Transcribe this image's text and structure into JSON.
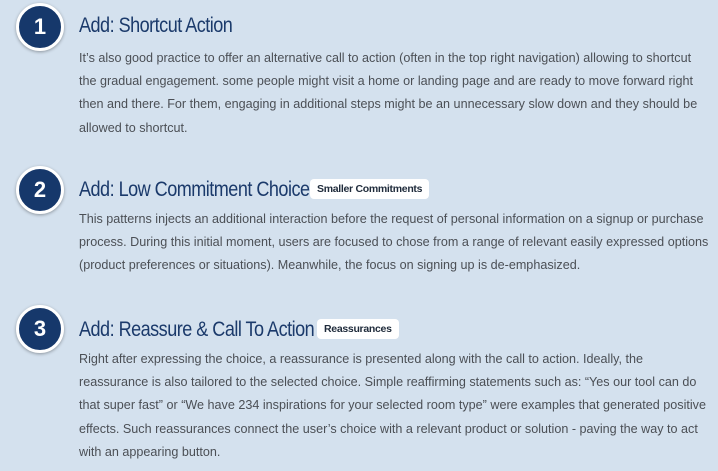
{
  "steps": [
    {
      "number": "1",
      "title": "Add: Shortcut Action",
      "tag": "",
      "description": "It’s also good practice to offer an alternative call to action (often in the top right navigation) allowing to shortcut the gradual engagement. some people might visit a home or landing page and are ready to move forward right then and there. For them, engaging in additional steps might be an unnecessary slow down and they should be allowed to shortcut."
    },
    {
      "number": "2",
      "title": "Add: Low Commitment Choice",
      "tag": "Smaller Commitments",
      "description": "This patterns injects an additional interaction before the request of personal information on a signup or purchase process. During this initial moment, users are focused to chose from a range of relevant easily expressed options (product preferences or situations). Meanwhile, the focus on signing up is de-emphasized."
    },
    {
      "number": "3",
      "title": "Add: Reassure & Call To Action",
      "tag": "Reassurances",
      "description": "Right after expressing the choice, a reassurance is presented along with the call to action. Ideally, the reassurance is also tailored to the selected choice. Simple reaffirming statements such as: “Yes our tool can do that super fast” or “We have 234 inspirations for your selected room type” were examples that generated positive effects. Such reassurances connect the user’s choice with a relevant product or solution - paving the way to act with an appearing button."
    }
  ],
  "colors": {
    "background": "#d4e1ee",
    "badge": "#16386b",
    "heading": "#1b3a6b",
    "body_text": "#4b4f55",
    "tag_background": "#ffffff"
  }
}
